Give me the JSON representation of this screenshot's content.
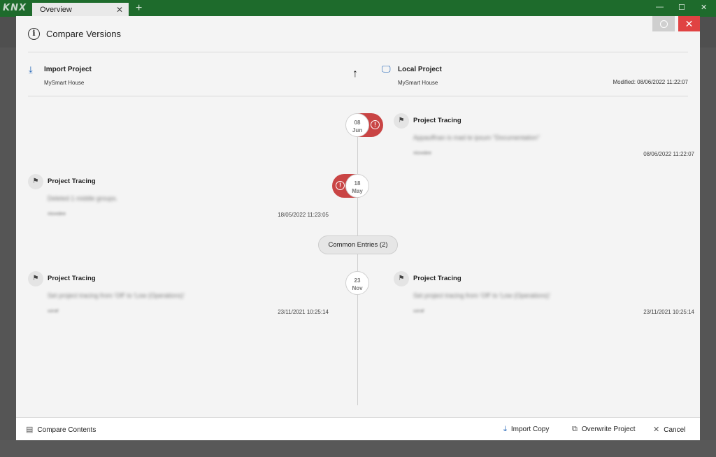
{
  "window": {
    "logo": "KNX",
    "tab_label": "Overview",
    "tab_close": "✕",
    "tab_add": "+",
    "minimize": "—",
    "maximize": "☐",
    "close": "✕"
  },
  "dialog": {
    "title": "Compare Versions",
    "close_glyph": "✕",
    "import_project": {
      "label": "Import Project",
      "name": "MySmart House"
    },
    "local_project": {
      "label": "Local Project",
      "name": "MySmart House",
      "modified": "Modified: 08/06/2022 11:22:07"
    },
    "timeline": {
      "dates": [
        {
          "day": "08",
          "month": "Jun"
        },
        {
          "day": "18",
          "month": "May"
        },
        {
          "day": "23",
          "month": "Nov"
        }
      ],
      "common_entries": "Common Entries (2)",
      "entries": [
        {
          "title": "Project Tracing",
          "description": "Appauffnan is mad te ipsum \"Documentation\"",
          "user": "nlovidee",
          "time": "08/06/2022 11:22:07"
        },
        {
          "title": "Project Tracing",
          "description": "Deleted 1 middle groups.",
          "user": "nlovidee",
          "time": "18/05/2022 11:23:05"
        },
        {
          "title": "Project Tracing",
          "description": "Set project tracing from 'Off' to 'Low (Operations)'",
          "user": "usraf",
          "time": "23/11/2021 10:25:14"
        },
        {
          "title": "Project Tracing",
          "description": "Set project tracing from 'Off' to 'Low (Operations)'",
          "user": "usraf",
          "time": "23/11/2021 10:25:14"
        }
      ]
    },
    "footer": {
      "compare_contents": "Compare Contents",
      "import_copy": "Import Copy",
      "overwrite_project": "Overwrite Project",
      "cancel": "Cancel"
    }
  },
  "icons": {
    "info": "i",
    "import": "⤓",
    "monitor": "🖵",
    "arrow_up": "↑",
    "flag": "⚑",
    "warning": "!",
    "document": "▤",
    "overwrite": "⧉",
    "cancel": "✕"
  },
  "colors": {
    "accent": "#1a5fb4",
    "danger": "#c94444",
    "titlebar": "#1e6b2c"
  }
}
